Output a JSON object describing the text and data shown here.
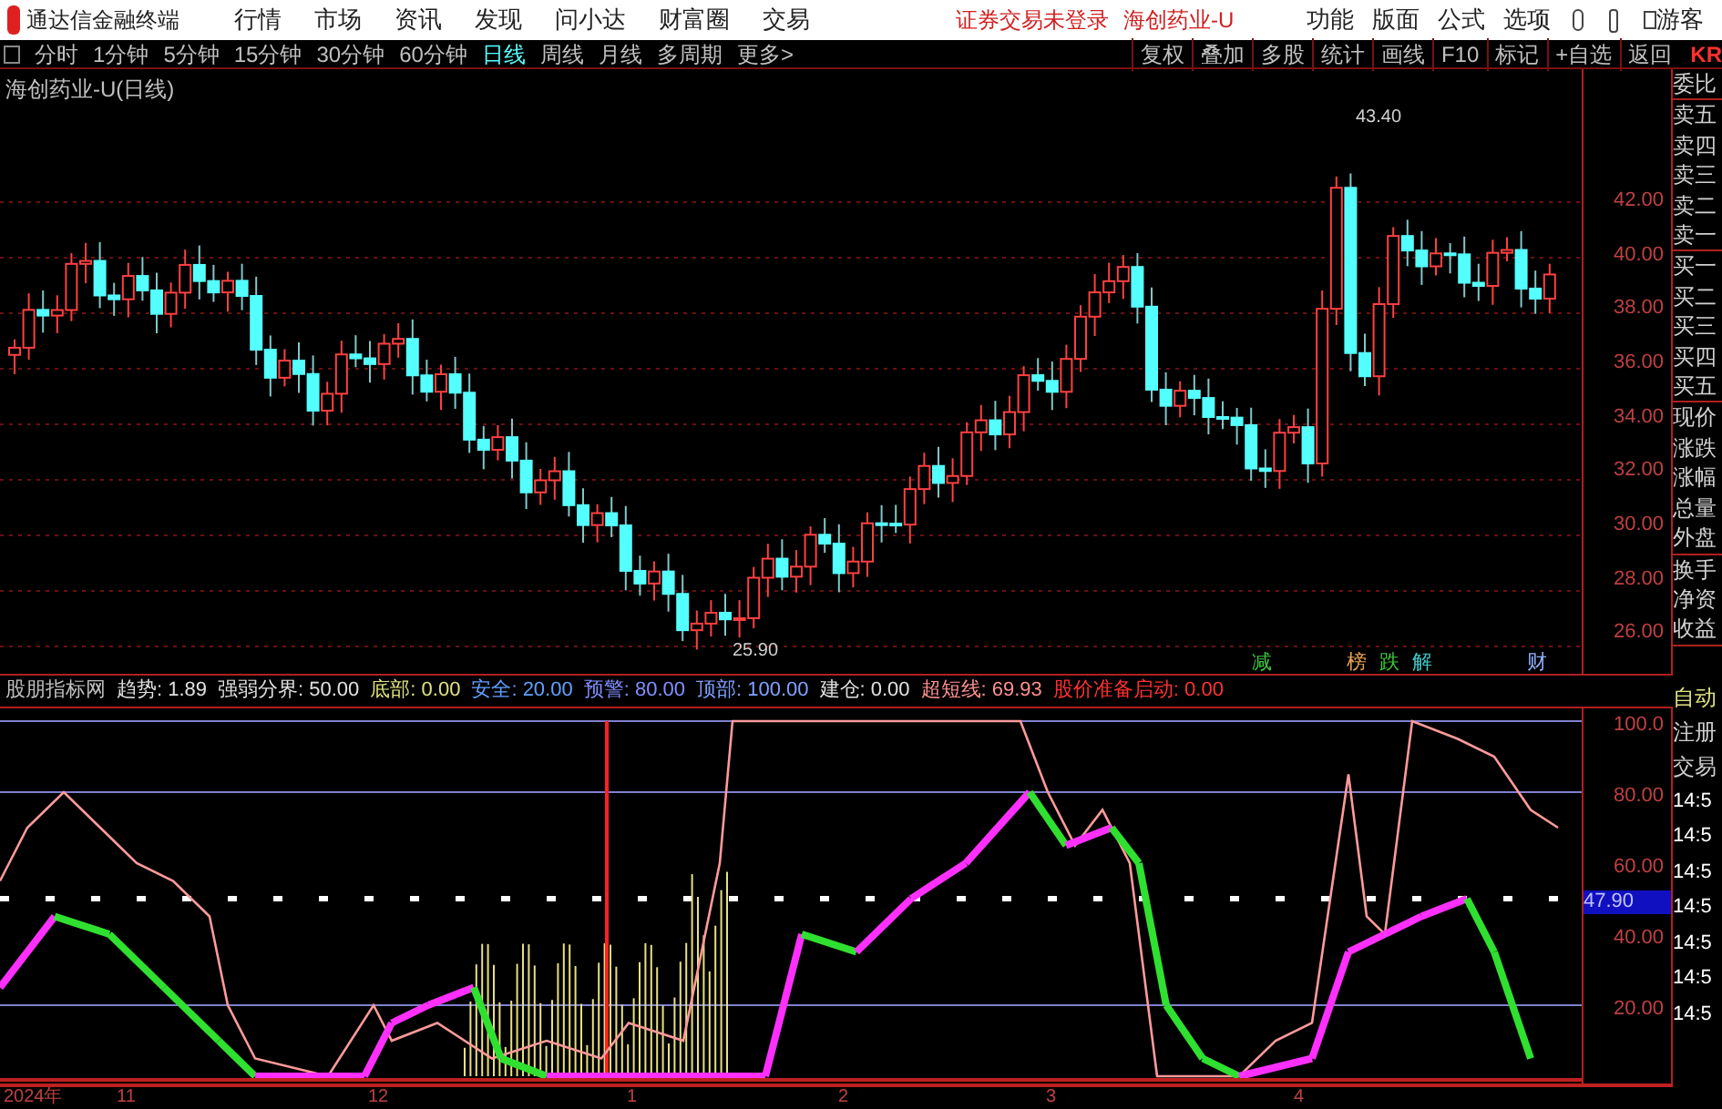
{
  "title_bar": {
    "app_name": "通达信金融终端",
    "menu": [
      "行情",
      "市场",
      "资讯",
      "发现",
      "问小达",
      "财富圈",
      "交易"
    ],
    "login_status": "证券交易未登录",
    "stock": "海创药业-U",
    "tools": [
      "功能",
      "版面",
      "公式",
      "选项"
    ],
    "user": "游客"
  },
  "toolbar": {
    "periods": [
      {
        "label": "分时",
        "selected": false
      },
      {
        "label": "1分钟",
        "selected": false
      },
      {
        "label": "5分钟",
        "selected": false
      },
      {
        "label": "15分钟",
        "selected": false
      },
      {
        "label": "30分钟",
        "selected": false
      },
      {
        "label": "60分钟",
        "selected": false
      },
      {
        "label": "日线",
        "selected": true
      },
      {
        "label": "周线",
        "selected": false
      },
      {
        "label": "月线",
        "selected": false
      },
      {
        "label": "多周期",
        "selected": false
      },
      {
        "label": "更多>",
        "selected": false
      }
    ],
    "actions": [
      "复权",
      "叠加",
      "多股",
      "统计",
      "画线",
      "F10",
      "标记",
      "+自选",
      "返回"
    ],
    "edge_text": "KR"
  },
  "price_chart": {
    "title": "海创药业-U(日线)",
    "high_label": "43.40",
    "low_label": "25.90",
    "y_ticks": [
      "42.00",
      "40.00",
      "38.00",
      "36.00",
      "34.00",
      "32.00",
      "30.00",
      "28.00",
      "26.00"
    ],
    "event_markers": [
      {
        "label": "减",
        "color": "#3cc83c"
      },
      {
        "label": "榜",
        "color": "#e8a050"
      },
      {
        "label": "跌",
        "color": "#3cc83c"
      },
      {
        "label": "解",
        "color": "#40c8c8"
      },
      {
        "label": "财",
        "color": "#90b0ff"
      }
    ]
  },
  "indicator": {
    "name": "股朋指标网",
    "values": [
      {
        "text": "趋势: 1.89",
        "kind": "neutral"
      },
      {
        "text": "强弱分界: 50.00",
        "kind": "neutral"
      },
      {
        "text": "底部: 0.00",
        "kind": "bottom"
      },
      {
        "text": "安全: 20.00",
        "kind": "safe"
      },
      {
        "text": "预警: 80.00",
        "kind": "warning"
      },
      {
        "text": "顶部: 100.00",
        "kind": "top"
      },
      {
        "text": "建仓: 0.00",
        "kind": "neutral"
      },
      {
        "text": "超短线: 69.93",
        "kind": "shortterm"
      },
      {
        "text": "股价准备启动: 0.00",
        "kind": "signal"
      }
    ],
    "y_ticks": [
      "100.0",
      "80.00",
      "60.00",
      "40.00",
      "20.00"
    ],
    "current_value": "47.90"
  },
  "date_axis": [
    "2024年",
    "11",
    "12",
    "1",
    "2",
    "3",
    "4"
  ],
  "side_panel": {
    "quote_labels": [
      "委比",
      "卖五",
      "卖四",
      "卖三",
      "卖二",
      "卖一",
      "买一",
      "买二",
      "买三",
      "买四",
      "买五",
      "现价",
      "涨跌",
      "涨幅",
      "总量",
      "外盘",
      "换手",
      "净资",
      "收益"
    ],
    "bottom_labels": [
      "自动",
      "注册",
      "交易"
    ],
    "times": [
      "14:5",
      "14:5",
      "14:5",
      "14:5",
      "14:5",
      "14:5",
      "14:5"
    ]
  }
}
